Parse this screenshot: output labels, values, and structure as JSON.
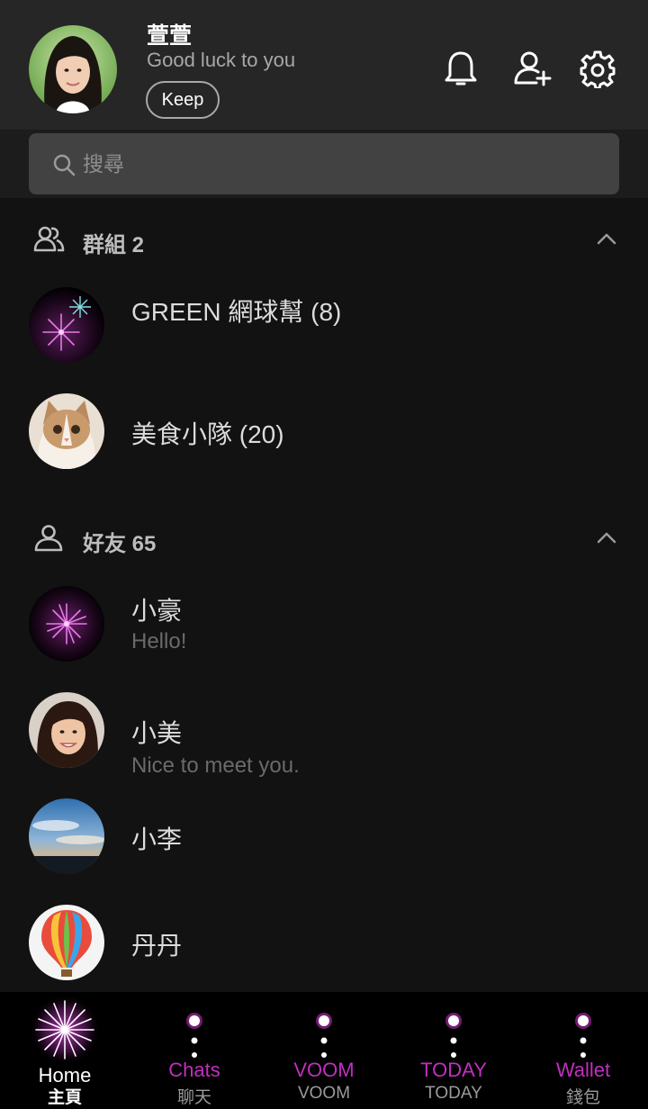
{
  "profile": {
    "name": "萱萱",
    "status": "Good luck to you",
    "keep_label": "Keep"
  },
  "header_icons": [
    "bell-icon",
    "add-friend-icon",
    "gear-icon"
  ],
  "search": {
    "placeholder": "搜尋"
  },
  "groups": {
    "title": "群組 2",
    "items": [
      {
        "name": "GREEN 網球幫 (8)"
      },
      {
        "name": "美食小隊 (20)"
      }
    ]
  },
  "friends": {
    "title": "好友 65",
    "items": [
      {
        "name": "小豪",
        "status": "Hello!"
      },
      {
        "name": "小美",
        "status": "Nice to meet you."
      },
      {
        "name": "小李",
        "status": ""
      },
      {
        "name": "丹丹",
        "status": ""
      }
    ]
  },
  "nav": {
    "items": [
      {
        "label": "Home",
        "sub": "主頁",
        "active": true
      },
      {
        "label": "Chats",
        "sub": "聊天",
        "active": false
      },
      {
        "label": "VOOM",
        "sub": "VOOM",
        "active": false
      },
      {
        "label": "TODAY",
        "sub": "TODAY",
        "active": false
      },
      {
        "label": "Wallet",
        "sub": "錢包",
        "active": false
      }
    ]
  },
  "colors": {
    "accent": "#c02fc0",
    "header_bg": "#262626",
    "body_bg": "#121212",
    "nav_bg": "#000000"
  }
}
